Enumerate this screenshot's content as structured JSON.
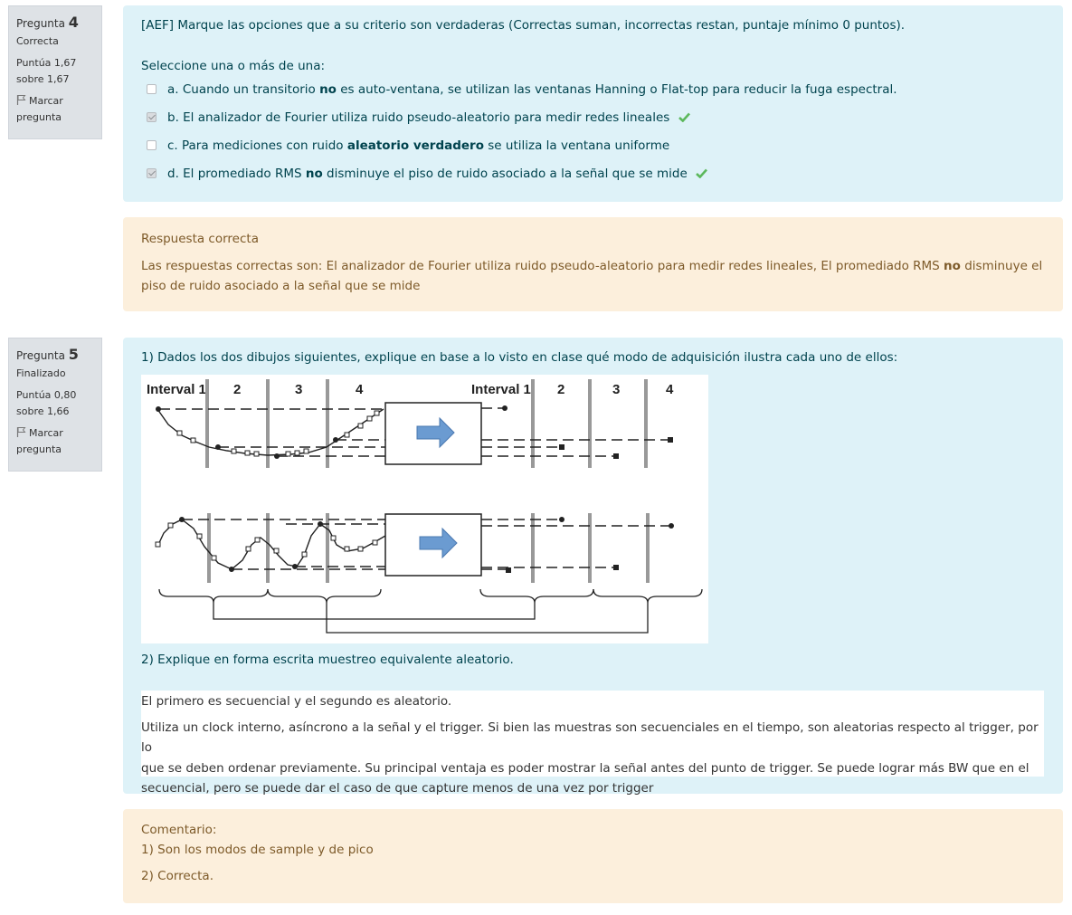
{
  "q4": {
    "label": "Pregunta",
    "number": "4",
    "state": "Correcta",
    "grade_line1": "Puntúa 1,67",
    "grade_line2": "sobre 1,67",
    "flag_line1": "Marcar",
    "flag_line2": "pregunta",
    "question_text": "[AEF] Marque las opciones que a su criterio son verdaderas (Correctas suman, incorrectas restan, puntaje mínimo 0 puntos).",
    "prompt": "Seleccione una o más de una:",
    "options": [
      {
        "pre": "a. Cuando un transitorio ",
        "bold": "no",
        "post": " es auto-ventana, se utilizan las ventanas Hanning o Flat-top para reducir la fuga espectral.",
        "checked": false,
        "correct_mark": false
      },
      {
        "pre": "b. El analizador de Fourier utiliza ruido pseudo-aleatorio para medir redes lineales",
        "bold": "",
        "post": "",
        "checked": true,
        "correct_mark": true
      },
      {
        "pre": "c. Para mediciones con ruido ",
        "bold": "aleatorio verdadero",
        "post": " se utiliza la ventana uniforme",
        "checked": false,
        "correct_mark": false
      },
      {
        "pre": "d. El promediado RMS ",
        "bold": "no",
        "post": " disminuye el piso de ruido asociado a la señal que se mide",
        "checked": true,
        "correct_mark": true
      }
    ],
    "feedback_title": "Respuesta correcta",
    "feedback_line1_pre": "Las respuestas correctas son: El analizador de Fourier utiliza ruido pseudo-aleatorio para medir redes lineales, El promediado RMS ",
    "feedback_line1_bold": "no",
    "feedback_line1_post": " disminuye el",
    "feedback_line2": "piso de ruido asociado a la señal que se mide"
  },
  "q5": {
    "label": "Pregunta",
    "number": "5",
    "state": "Finalizado",
    "grade_line1": "Puntúa 0,80",
    "grade_line2": "sobre 1,66",
    "flag_line1": "Marcar",
    "flag_line2": "pregunta",
    "question_text": "1) Dados los dos dibujos siguientes, explique en base a lo visto en clase qué modo de adquisición ilustra cada uno de ellos:",
    "figure_labels": {
      "left": [
        "Interval 1",
        "2",
        "3",
        "4"
      ],
      "right": [
        "Interval 1",
        "2",
        "3",
        "4"
      ]
    },
    "question_text2": "2) Explique en forma escrita muestreo equivalente aleatorio.",
    "answer_line1": "El primero es secuencial y el segundo es aleatorio.",
    "answer_para": [
      "Utiliza un clock interno, asíncrono a la señal y el trigger. Si bien las muestras son secuenciales en el tiempo, son aleatorias respecto al trigger, por lo",
      "que se deben ordenar previamente. Su principal ventaja es poder mostrar la señal antes del punto de trigger. Se puede lograr más BW que en el",
      "secuencial, pero se puede dar el caso de que capture menos de una vez por trigger"
    ],
    "comment_title": "Comentario:",
    "comment_1": "1) Son los modos de sample y de pico",
    "comment_2": "2) Correcta."
  },
  "colors": {
    "info_bg": "#dee2e6",
    "question_bg": "#def2f8",
    "feedback_bg": "#fcefdc",
    "correct_green": "#5cb85c"
  }
}
